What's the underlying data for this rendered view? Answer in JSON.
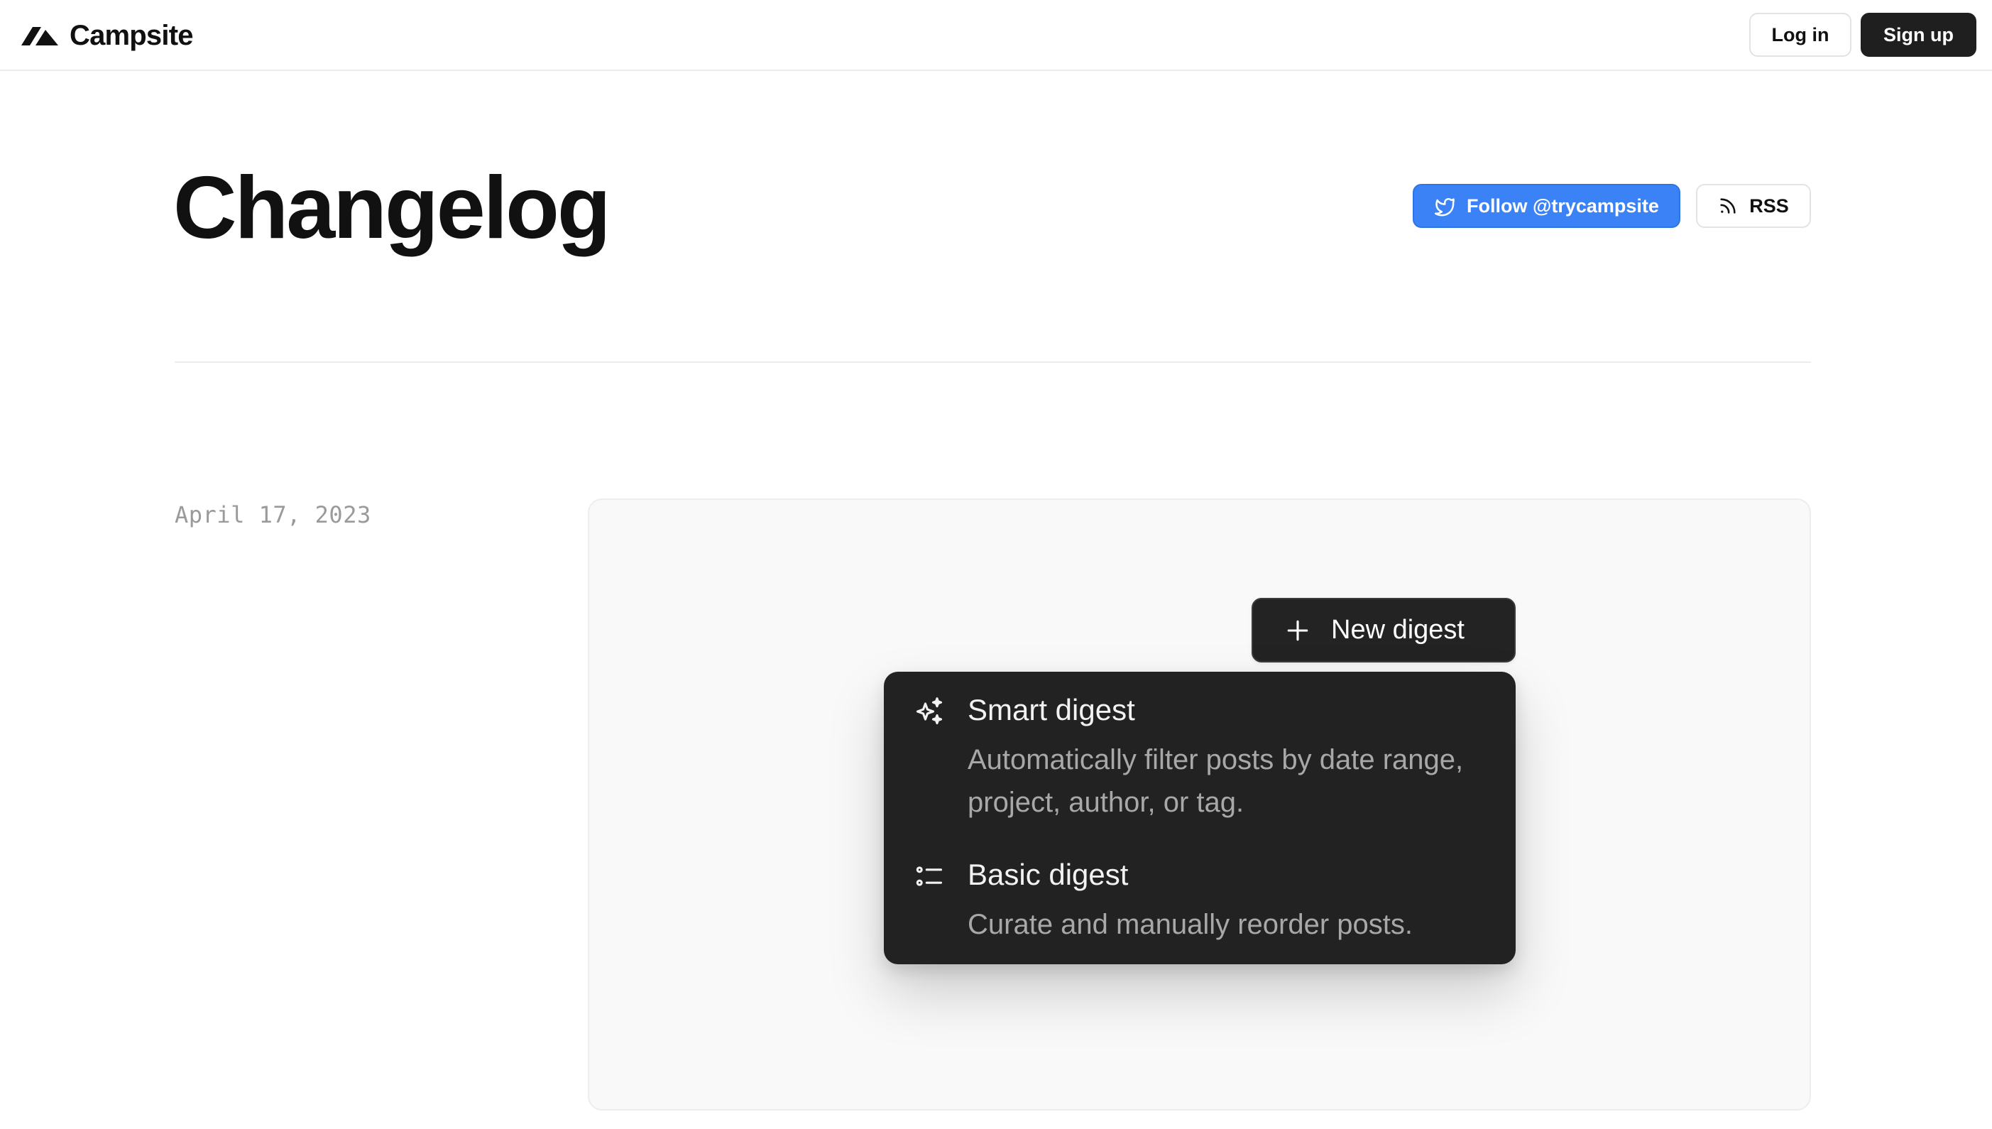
{
  "header": {
    "brand": "Campsite",
    "login_label": "Log in",
    "signup_label": "Sign up"
  },
  "page": {
    "title": "Changelog",
    "follow_label": "Follow @trycampsite",
    "rss_label": "RSS"
  },
  "entry": {
    "date": "April 17, 2023",
    "preview": {
      "new_digest_label": "New digest",
      "menu": [
        {
          "icon": "sparkles-icon",
          "title": "Smart digest",
          "description": "Automatically filter posts by date range, project, author, or tag."
        },
        {
          "icon": "list-icon",
          "title": "Basic digest",
          "description": "Curate and manually reorder posts."
        }
      ]
    }
  },
  "colors": {
    "accent_blue": "#3b82f6",
    "dark": "#1f1f1f",
    "menu_bg": "#222222",
    "muted_text": "#9a9a9a"
  }
}
